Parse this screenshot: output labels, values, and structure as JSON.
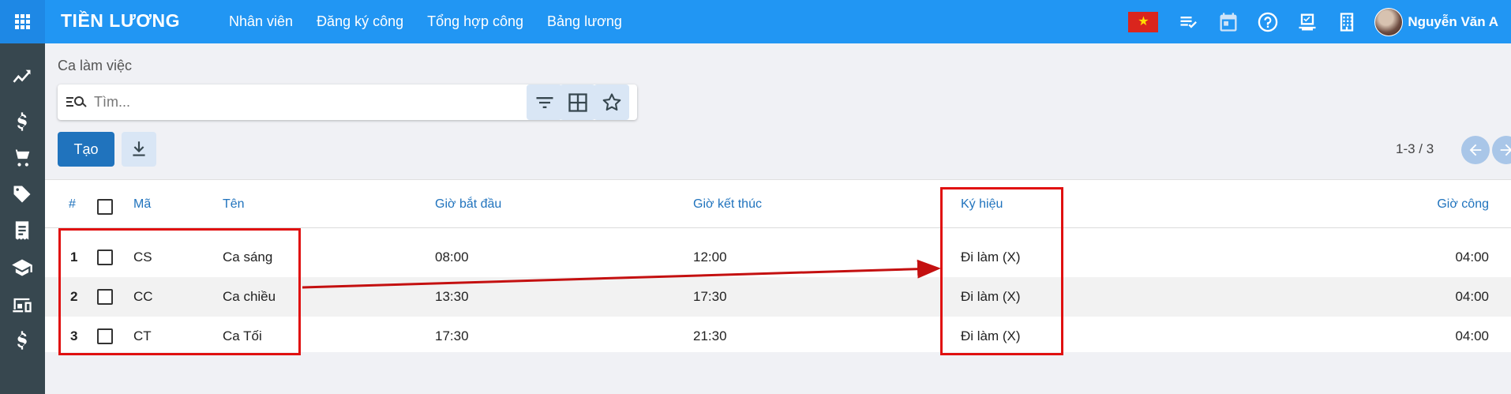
{
  "app": {
    "brand": "TIỀN LƯƠNG",
    "nav": [
      "Nhân viên",
      "Đăng ký công",
      "Tổng hợp công",
      "Bảng lương"
    ],
    "user_name": "Nguyễn Văn A",
    "flag_star": "★"
  },
  "sidebar": {
    "icons": [
      "dashboard-trend-icon",
      "dollar-icon",
      "cart-icon",
      "tag-icon",
      "receipt-icon",
      "school-icon",
      "devices-icon",
      "dollar-icon"
    ]
  },
  "control": {
    "breadcrumb": "Ca làm việc",
    "search_placeholder": "Tìm...",
    "create_label": "Tạo",
    "pager": "1-3 / 3"
  },
  "table": {
    "headers": {
      "index": "#",
      "code": "Mã",
      "name": "Tên",
      "start": "Giờ bắt đầu",
      "end": "Giờ kết thúc",
      "symbol": "Ký hiệu",
      "hours": "Giờ công"
    },
    "rows": [
      {
        "index": "1",
        "code": "CS",
        "name": "Ca sáng",
        "start": "08:00",
        "end": "12:00",
        "symbol": "Đi làm (X)",
        "hours": "04:00"
      },
      {
        "index": "2",
        "code": "CC",
        "name": "Ca chiều",
        "start": "13:30",
        "end": "17:30",
        "symbol": "Đi làm (X)",
        "hours": "04:00"
      },
      {
        "index": "3",
        "code": "CT",
        "name": "Ca Tối",
        "start": "17:30",
        "end": "21:30",
        "symbol": "Đi làm (X)",
        "hours": "04:00"
      }
    ]
  },
  "colors": {
    "topbar": "#2196f3",
    "sidebar": "#37474f",
    "primary": "#2073bd",
    "annotation": "#e01010"
  }
}
